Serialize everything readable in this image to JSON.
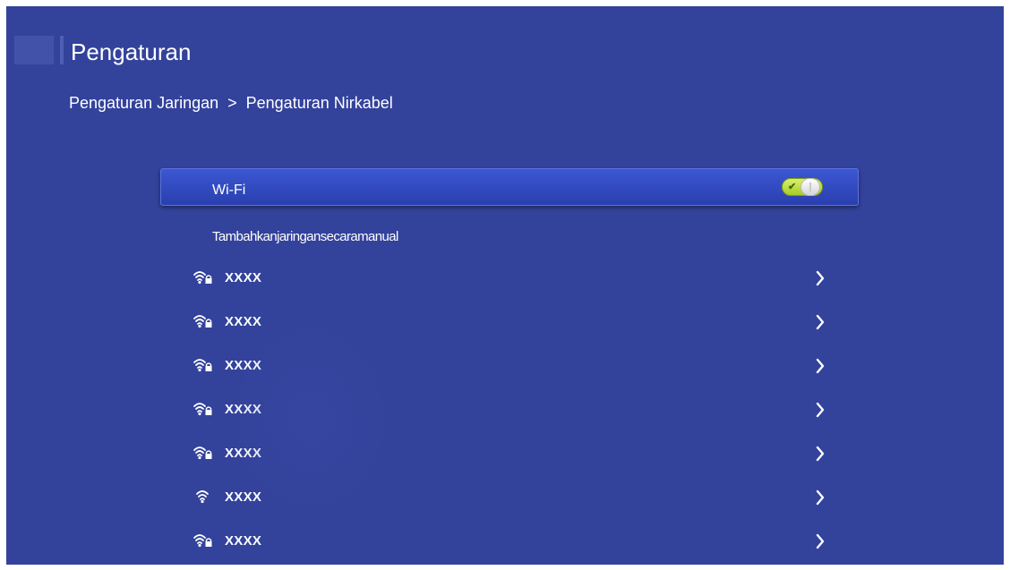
{
  "header": {
    "title": "Pengaturan"
  },
  "breadcrumb": {
    "parent": "Pengaturan Jaringan",
    "separator": ">",
    "current": "Pengaturan Nirkabel"
  },
  "wifi": {
    "label": "Wi-Fi",
    "enabled": true
  },
  "manual_add": {
    "label": "Tambahkanjaringansecaramanual"
  },
  "networks": [
    {
      "name": "XXXX",
      "secured": true,
      "icon": "wifi-lock-icon"
    },
    {
      "name": "XXXX",
      "secured": true,
      "icon": "wifi-lock-icon"
    },
    {
      "name": "XXXX",
      "secured": true,
      "icon": "wifi-lock-icon"
    },
    {
      "name": "XXXX",
      "secured": true,
      "icon": "wifi-lock-icon"
    },
    {
      "name": "XXXX",
      "secured": true,
      "icon": "wifi-lock-icon"
    },
    {
      "name": "XXXX",
      "secured": false,
      "icon": "wifi-icon"
    },
    {
      "name": "XXXX",
      "secured": true,
      "icon": "wifi-lock-icon"
    }
  ],
  "colors": {
    "background": "#33429b",
    "highlight": "#3c57d3",
    "toggle_on": "#b8dc3a",
    "text": "#ffffff"
  }
}
